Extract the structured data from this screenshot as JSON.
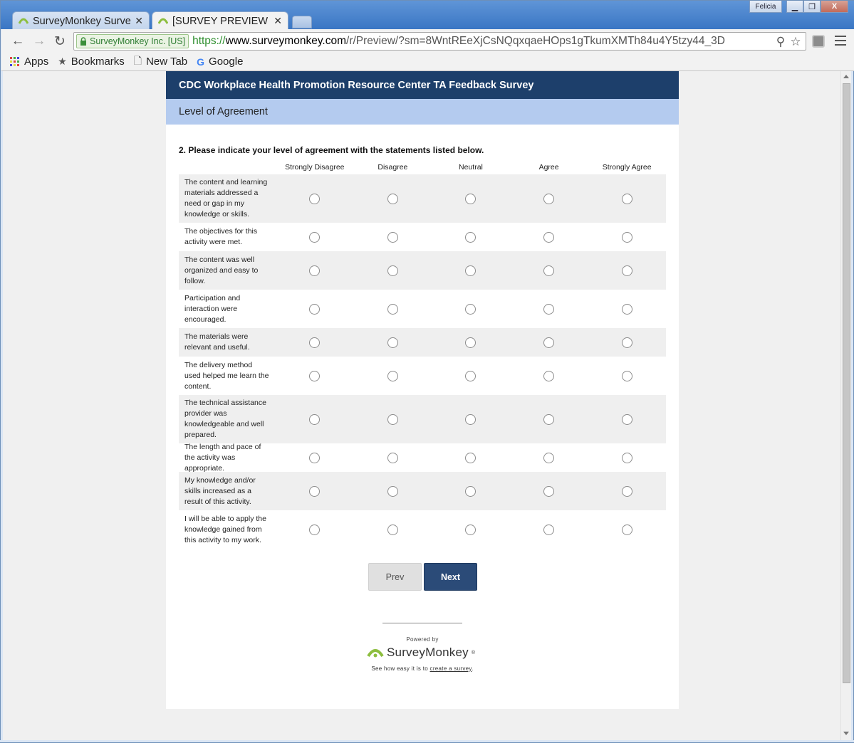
{
  "browser": {
    "user": "Felicia",
    "tabs": [
      {
        "title": "SurveyMonkey Surve",
        "active": false
      },
      {
        "title": "[SURVEY PREVIEW M",
        "active": true
      }
    ],
    "ev_badge": "SurveyMonkey Inc. [US]",
    "url_scheme": "https://",
    "url_host": "www.surveymonkey.com",
    "url_path": "/r/Preview/?sm=8WntREeXjCsNQqxqaeHOps1gTkumXMTh84u4Y5tzy44_3D",
    "bookmarks": [
      "Apps",
      "Bookmarks",
      "New Tab",
      "Google"
    ]
  },
  "survey": {
    "title": "CDC Workplace Health Promotion Resource Center TA Feedback Survey",
    "page_title": "Level of Agreement",
    "question": "2. Please indicate your level of agreement with the statements listed below.",
    "columns": [
      "Strongly Disagree",
      "Disagree",
      "Neutral",
      "Agree",
      "Strongly Agree"
    ],
    "rows": [
      "The content and learning materials addressed a need or gap in my knowledge or skills.",
      "The objectives for this activity were met.",
      "The content was well organized and easy to follow.",
      "Participation and interaction were encouraged.",
      "The materials were relevant and useful.",
      "The delivery method used helped me learn the content.",
      "The technical assistance provider was knowledgeable and well prepared.",
      "The length and pace of the activity was appropriate.",
      "My knowledge and/or skills increased as a result of this activity.",
      "I will be able to apply the knowledge gained from this activity to my work."
    ],
    "prev_label": "Prev",
    "next_label": "Next"
  },
  "footer": {
    "powered_by": "Powered by",
    "brand": "SurveyMonkey",
    "tagline_prefix": "See how easy it is to ",
    "tagline_link": "create a survey",
    "tagline_suffix": "."
  },
  "colors": {
    "header_bg": "#1d3f6b",
    "page_title_bg": "#b4cbef",
    "next_bg": "#2b4b78",
    "brand_green": "#8dbe3f"
  }
}
